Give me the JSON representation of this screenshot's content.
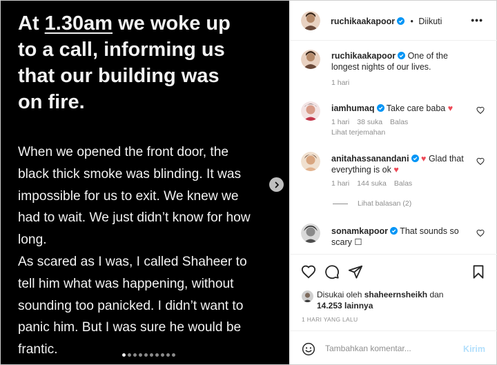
{
  "media": {
    "headline_pre": "At ",
    "headline_time": "1.30am",
    "headline_post": " we woke up to a call, informing us that our building was on fire.",
    "headline_lines": [
      "At",
      "1.30am",
      "we woke up",
      "to a call, informing us",
      "that our building was",
      "on fire."
    ],
    "body_lines": [
      "When we opened the front door, the",
      "black thick smoke was blinding. It was",
      "impossible for us to exit. We knew we",
      "had to wait. We just didn’t know for how",
      "long.",
      "As scared as I was, I called Shaheer to",
      "tell him what was happening, without",
      "sounding too panicked. I didn’t want to",
      "panic him. But I was sure he would be",
      "frantic."
    ],
    "next_icon": "chevron-right-icon",
    "carousel_total": 10,
    "carousel_active": 1
  },
  "header": {
    "username": "ruchikaakapoor",
    "separator": "•",
    "follow_status": "Diikuti",
    "more_icon": "more-horizontal-icon"
  },
  "caption": {
    "username": "ruchikaakapoor",
    "text": "One of the longest nights of our lives.",
    "time": "1 hari"
  },
  "comments": [
    {
      "username": "iamhumaq",
      "text": "Take care baba",
      "emoji": "♥",
      "time": "1 hari",
      "likes": "38 suka",
      "reply": "Balas",
      "translate": "Lihat terjemahan"
    },
    {
      "username": "anitahassanandani",
      "emoji_pre": "♥",
      "text": "Glad that everything is ok",
      "emoji": "♥",
      "time": "1 hari",
      "likes": "144 suka",
      "reply": "Balas",
      "view_replies": "Lihat balasan (2)"
    },
    {
      "username": "sonamkapoor",
      "text": "That sounds so scary",
      "emoji": "☐"
    }
  ],
  "actions": {
    "like_icon": "heart-icon",
    "comment_icon": "comment-icon",
    "share_icon": "send-icon",
    "save_icon": "bookmark-icon"
  },
  "likes": {
    "line1": "Disukai oleh",
    "user": "shaheernsheikh",
    "and": "dan",
    "count": "14.253 lainnya"
  },
  "post_date": "1 HARI YANG LALU",
  "add_comment": {
    "placeholder": "Tambahkan komentar...",
    "send_label": "Kirim",
    "emoji_icon": "smile-icon"
  },
  "colors": {
    "accent_blue": "#0095f6",
    "send_disabled": "#b2dffc",
    "heart_red": "#ed4956",
    "muted": "#8e8e8e"
  }
}
